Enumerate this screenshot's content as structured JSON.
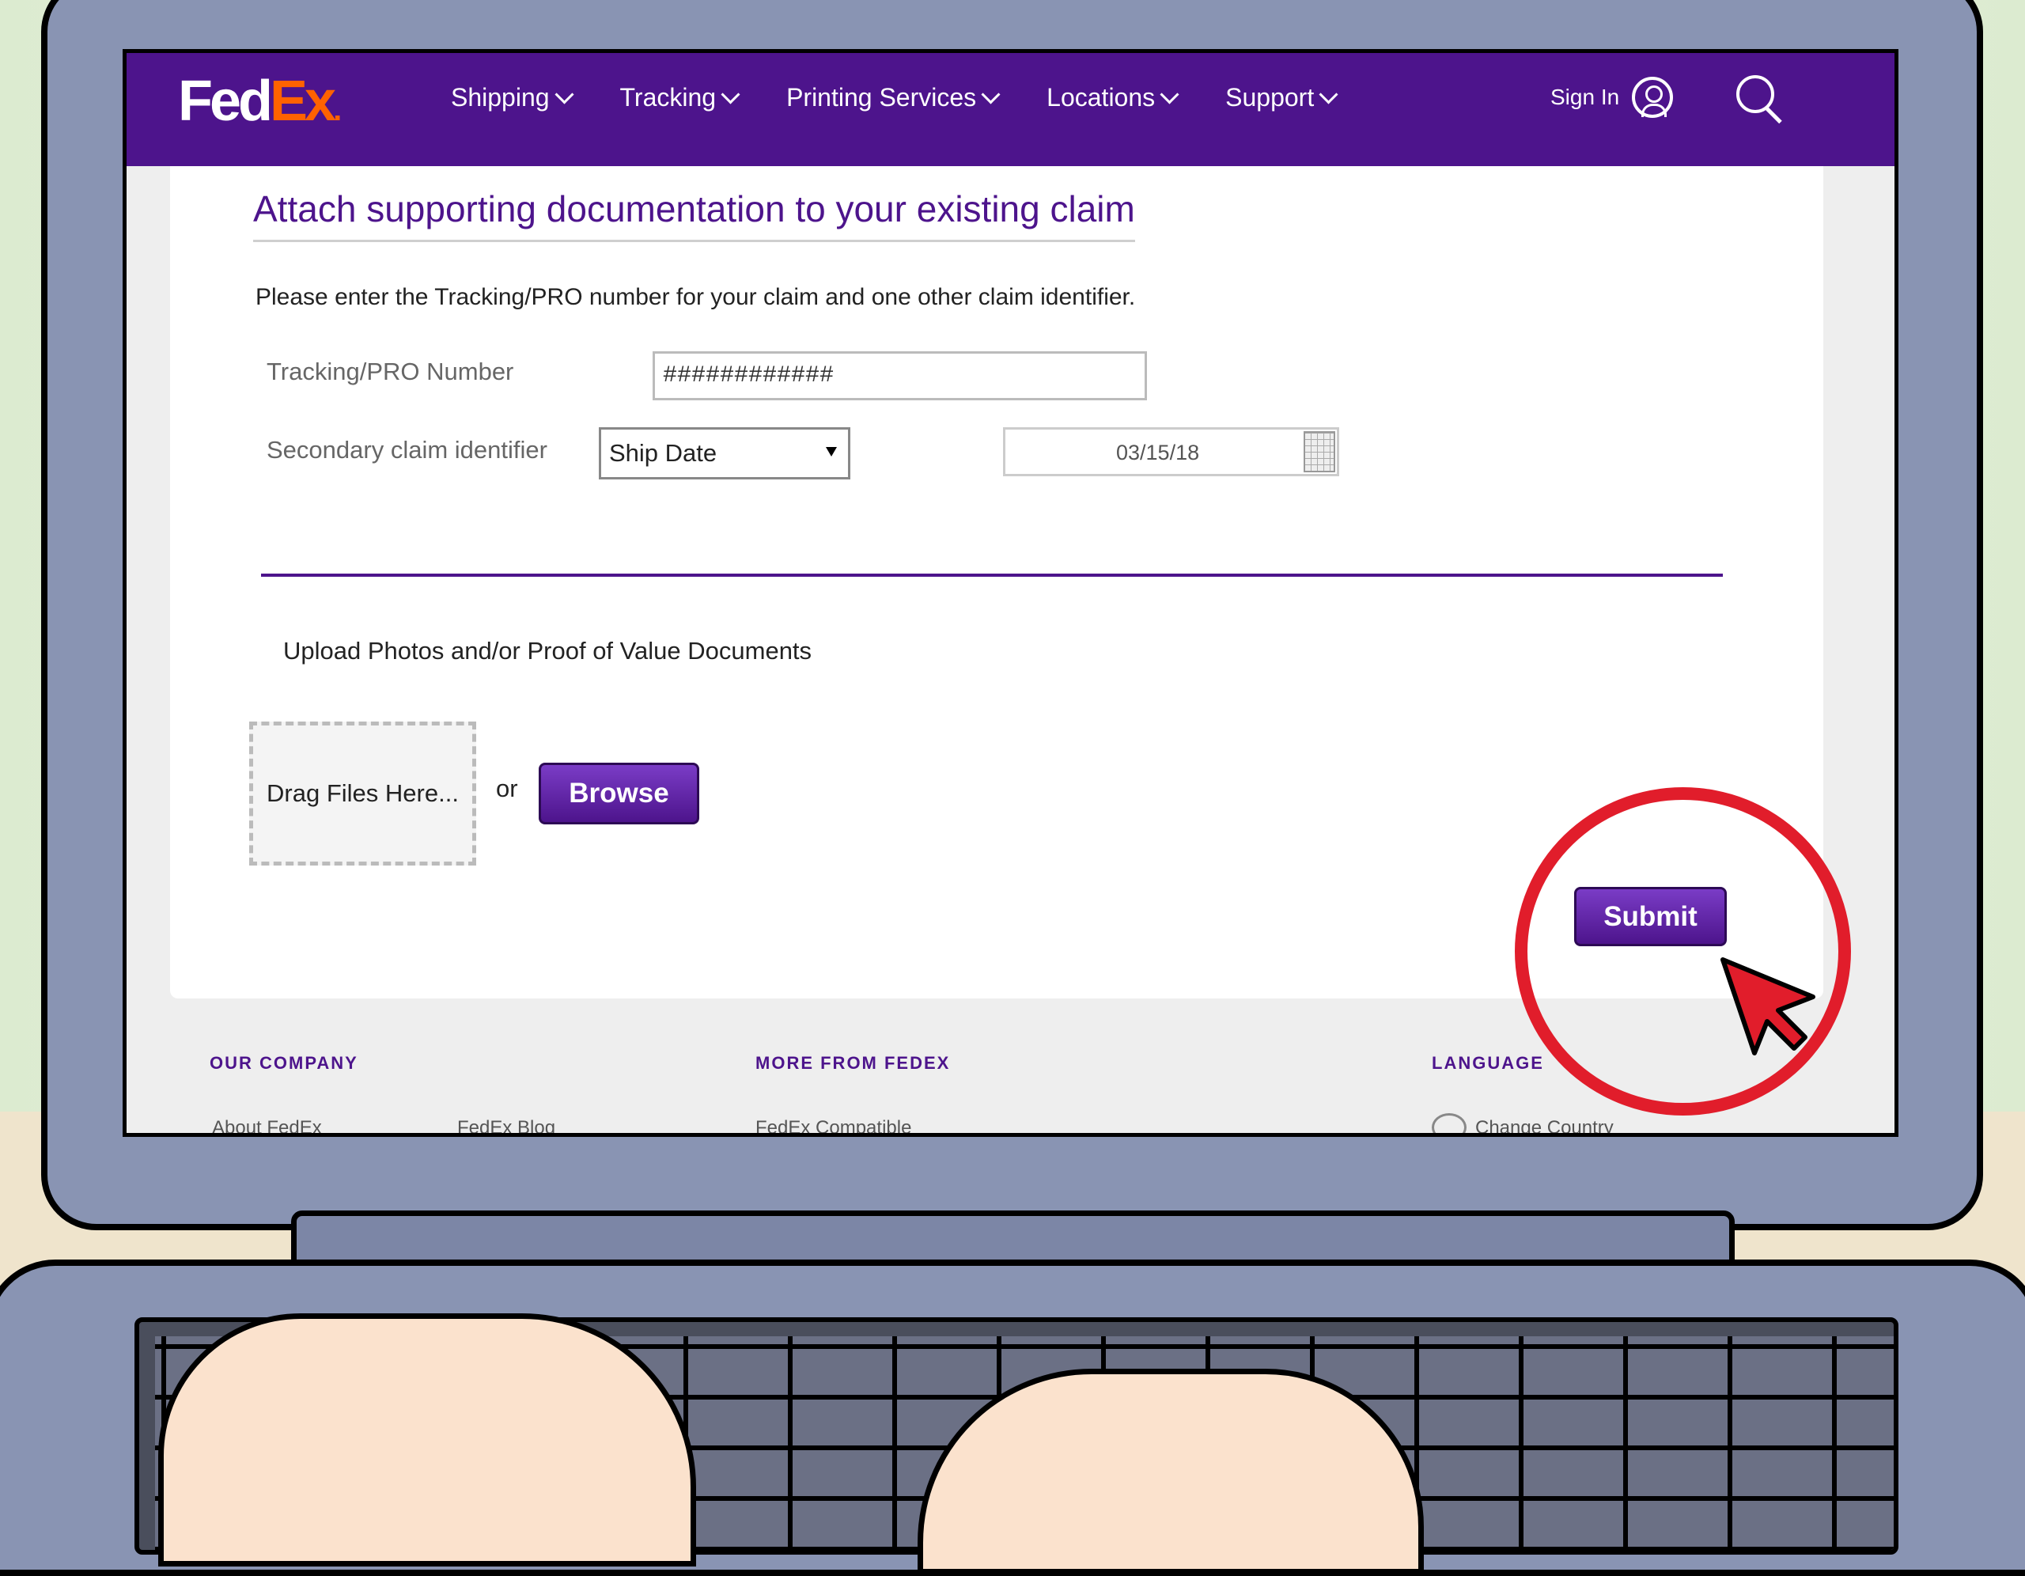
{
  "nav": {
    "logo_fed": "Fed",
    "logo_ex": "Ex",
    "logo_dot": ".",
    "items": [
      {
        "label": "Shipping"
      },
      {
        "label": "Tracking"
      },
      {
        "label": "Printing Services"
      },
      {
        "label": "Locations"
      },
      {
        "label": "Support"
      }
    ],
    "signin_label": "Sign In"
  },
  "form": {
    "title": "Attach supporting documentation to your existing claim",
    "instruction": "Please enter the Tracking/PRO number for your claim and one other claim identifier.",
    "tracking_label": "Tracking/PRO Number",
    "tracking_value": "############",
    "secondary_label": "Secondary claim identifier",
    "secondary_selected": "Ship Date",
    "date_value": "03/15/18",
    "upload_label": "Upload Photos and/or Proof of Value Documents",
    "drop_label": "Drag Files Here...",
    "or_label": "or",
    "browse_label": "Browse",
    "submit_label": "Submit"
  },
  "footer": {
    "col1_heading": "OUR COMPANY",
    "col1_link1": "About FedEx",
    "col1_link2": "FedEx Blog",
    "col2_heading": "MORE FROM FEDEX",
    "col2_link1": "FedEx Compatible",
    "col3_heading": "LANGUAGE",
    "col3_link1": "Change Country"
  },
  "colors": {
    "brand_purple": "#4d148c",
    "brand_orange": "#ff6200",
    "annotation_red": "#e11d2b"
  }
}
